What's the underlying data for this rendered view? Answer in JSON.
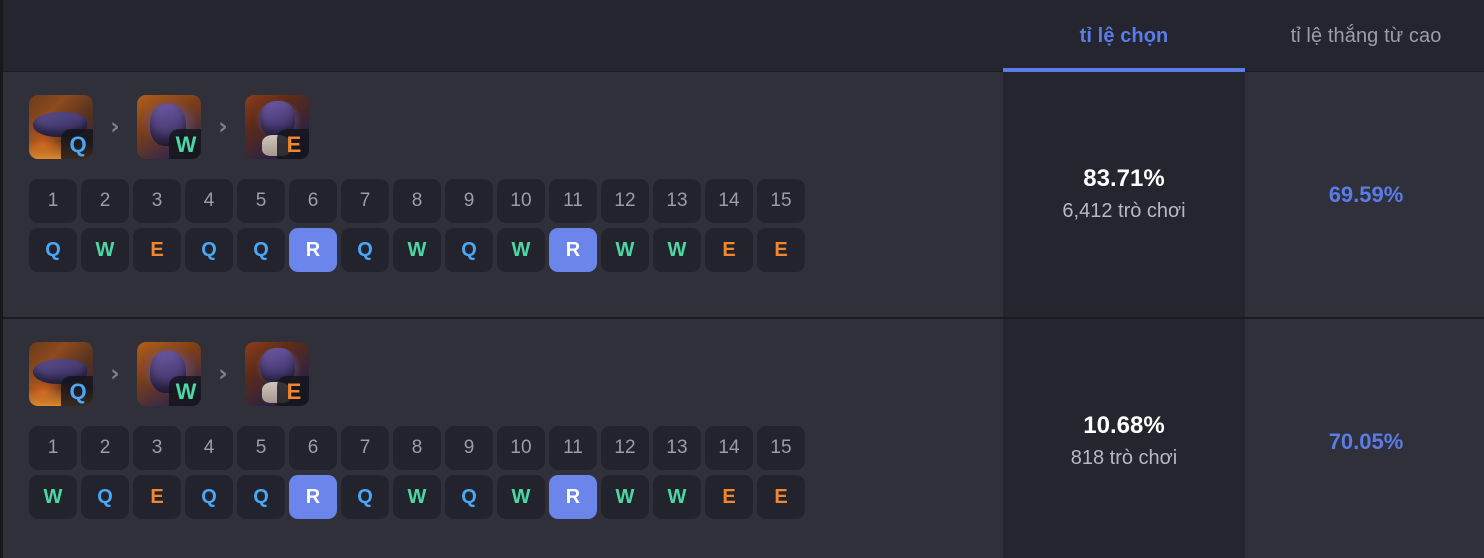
{
  "header": {
    "tabs": [
      {
        "label": "tỉ lệ chọn",
        "active": true,
        "name": "tab-pick-rate"
      },
      {
        "label": "tỉ lệ thắng từ cao",
        "active": false,
        "name": "tab-win-rate"
      }
    ]
  },
  "colors": {
    "accent": "#5a7ce8",
    "q": "#49a7f5",
    "w": "#4bd8a2",
    "e": "#f2862c",
    "r_bg": "#6b85ea",
    "bg": "#2f3039",
    "panel": "#24252e",
    "cell": "#22232c"
  },
  "arrow_glyph": "›",
  "rows": [
    {
      "path": [
        {
          "key": "Q",
          "icon": "ability-icon-q"
        },
        {
          "key": "W",
          "icon": "ability-icon-w"
        },
        {
          "key": "E",
          "icon": "ability-icon-e"
        }
      ],
      "levels": [
        "1",
        "2",
        "3",
        "4",
        "5",
        "6",
        "7",
        "8",
        "9",
        "10",
        "11",
        "12",
        "13",
        "14",
        "15"
      ],
      "skills": [
        "Q",
        "W",
        "E",
        "Q",
        "Q",
        "R",
        "Q",
        "W",
        "Q",
        "W",
        "R",
        "W",
        "W",
        "E",
        "E"
      ],
      "pick_rate": "83.71%",
      "games": "6,412 trò chơi",
      "win_rate": "69.59%"
    },
    {
      "path": [
        {
          "key": "Q",
          "icon": "ability-icon-q"
        },
        {
          "key": "W",
          "icon": "ability-icon-w"
        },
        {
          "key": "E",
          "icon": "ability-icon-e"
        }
      ],
      "levels": [
        "1",
        "2",
        "3",
        "4",
        "5",
        "6",
        "7",
        "8",
        "9",
        "10",
        "11",
        "12",
        "13",
        "14",
        "15"
      ],
      "skills": [
        "W",
        "Q",
        "E",
        "Q",
        "Q",
        "R",
        "Q",
        "W",
        "Q",
        "W",
        "R",
        "W",
        "W",
        "E",
        "E"
      ],
      "pick_rate": "10.68%",
      "games": "818 trò chơi",
      "win_rate": "70.05%"
    }
  ]
}
